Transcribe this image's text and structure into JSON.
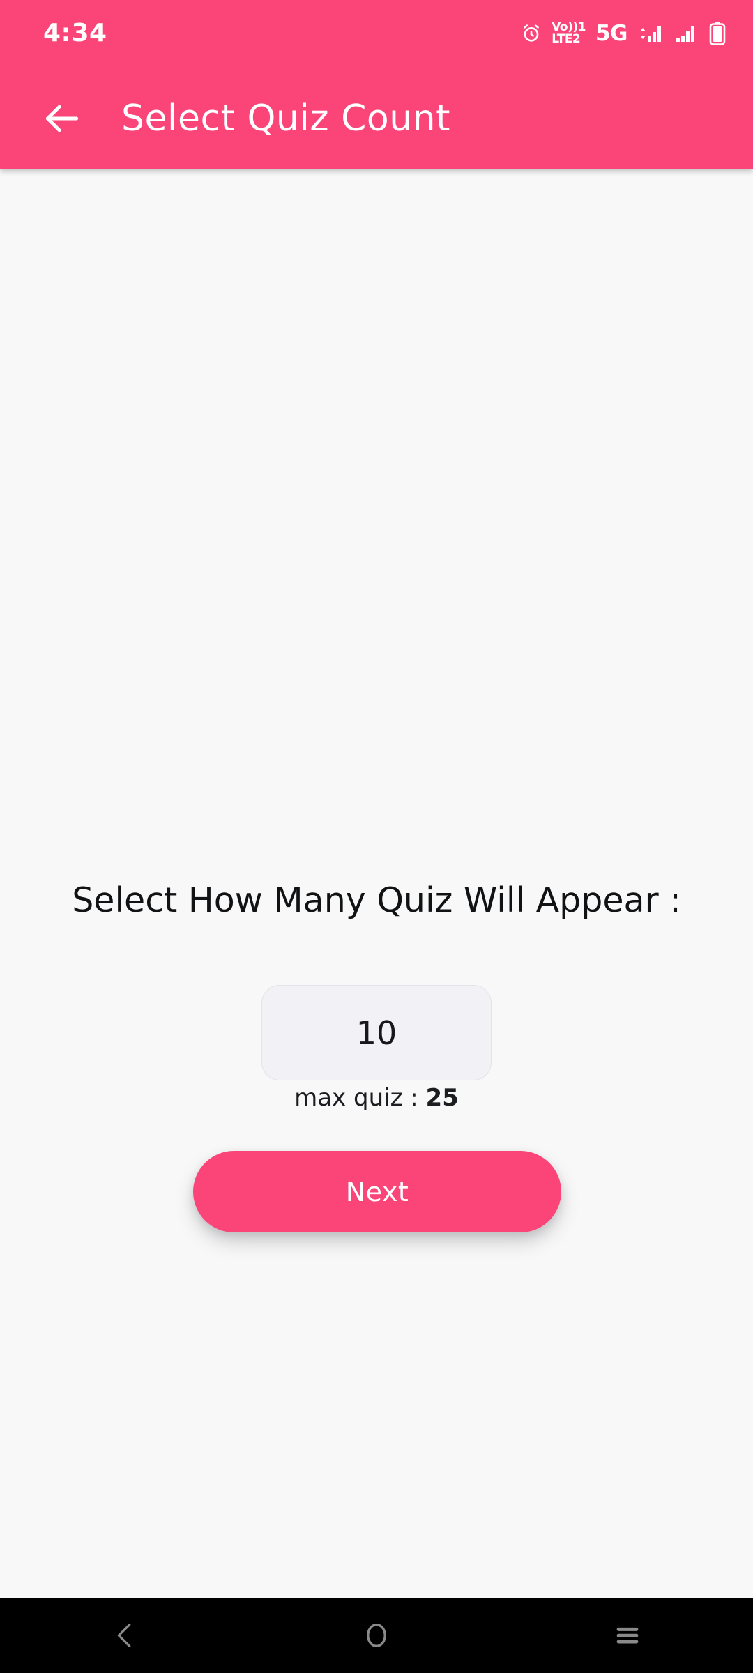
{
  "status_bar": {
    "clock": "4:34",
    "icons": [
      {
        "name": "alarm-icon",
        "label": ""
      },
      {
        "name": "volte-icon",
        "top_label": "Vo))1",
        "bottom_label": "LTE2"
      },
      {
        "name": "network-type-icon",
        "label": "5G"
      },
      {
        "name": "signal-bars-sim1-icon",
        "label": ""
      },
      {
        "name": "signal-bars-sim2-icon",
        "label": ""
      },
      {
        "name": "battery-icon",
        "label": ""
      }
    ],
    "background_color": "#fb4579"
  },
  "app_bar": {
    "back_label": "Back",
    "title": "Select Quiz Count",
    "background_color": "#fb4579",
    "text_color": "#ffffff"
  },
  "main": {
    "heading": "Select How Many Quiz Will Appear :",
    "count_input": {
      "value": "10",
      "placeholder": "10"
    },
    "max_quiz": {
      "label": "max quiz : ",
      "value": "25"
    },
    "next_button_label": "Next",
    "background_color": "#f8f8f8",
    "accent_color": "#fb4579"
  },
  "nav_bar": {
    "back_label": "Back",
    "home_label": "Home",
    "recents_label": "Recents",
    "background_color": "#000000",
    "icon_color": "#8a8a8a"
  }
}
